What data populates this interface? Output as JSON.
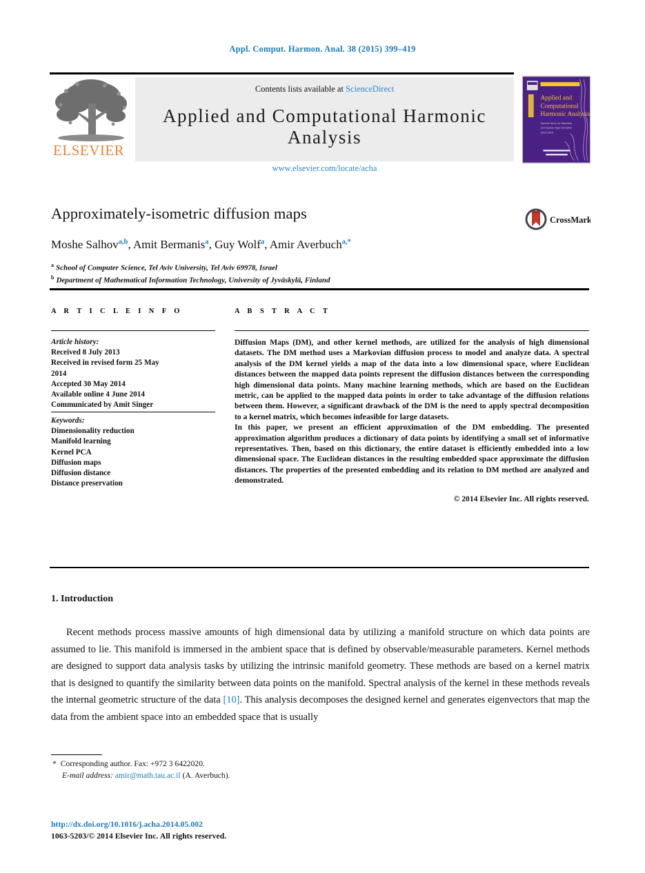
{
  "running_head": "Appl. Comput. Harmon. Anal. 38 (2015) 399–419",
  "masthead": {
    "publisher_name": "ELSEVIER",
    "publisher_logo_icon": "elsevier-tree-icon",
    "contents_prefix": "Contents lists available at",
    "contents_link": "ScienceDirect",
    "journal_title": "Applied and Computational Harmonic Analysis",
    "journal_url": "www.elsevier.com/locate/acha",
    "cover": {
      "line1": "Applied and",
      "line2": "Computational",
      "line3": "Harmonic Analysis",
      "background": "#4b2083",
      "accent": "#f2c430"
    }
  },
  "article": {
    "title": "Approximately-isometric diffusion maps",
    "crossmark_label": "CrossMark",
    "crossmark_icon": "crossmark-icon",
    "authors": [
      {
        "name": "Moshe Salhov",
        "marks": "a,b"
      },
      {
        "name": "Amit Bermanis",
        "marks": "a"
      },
      {
        "name": "Guy Wolf",
        "marks": "a"
      },
      {
        "name": "Amir Averbuch",
        "marks": "a,*"
      }
    ],
    "affiliations": [
      {
        "mark": "a",
        "text": "School of Computer Science, Tel Aviv University, Tel Aviv 69978, Israel"
      },
      {
        "mark": "b",
        "text": "Department of Mathematical Information Technology, University of Jyväskylä, Finland"
      }
    ]
  },
  "info": {
    "heading": "A R T I C L E   I N F O",
    "history_label": "Article history:",
    "history": [
      "Received 8 July 2013",
      "Received in revised form 25 May",
      "2014",
      "Accepted 30 May 2014",
      "Available online 4 June 2014",
      "Communicated by Amit Singer"
    ],
    "keywords_label": "Keywords:",
    "keywords": [
      "Dimensionality reduction",
      "Manifold learning",
      "Kernel PCA",
      "Diffusion maps",
      "Diffusion distance",
      "Distance preservation"
    ]
  },
  "abstract": {
    "heading": "A B S T R A C T",
    "paragraphs": [
      "Diffusion Maps (DM), and other kernel methods, are utilized for the analysis of high dimensional datasets. The DM method uses a Markovian diffusion process to model and analyze data. A spectral analysis of the DM kernel yields a map of the data into a low dimensional space, where Euclidean distances between the mapped data points represent the diffusion distances between the corresponding high dimensional data points. Many machine learning methods, which are based on the Euclidean metric, can be applied to the mapped data points in order to take advantage of the diffusion relations between them. However, a significant drawback of the DM is the need to apply spectral decomposition to a kernel matrix, which becomes infeasible for large datasets.",
      "In this paper, we present an efficient approximation of the DM embedding. The presented approximation algorithm produces a dictionary of data points by identifying a small set of informative representatives. Then, based on this dictionary, the entire dataset is efficiently embedded into a low dimensional space. The Euclidean distances in the resulting embedded space approximate the diffusion distances. The properties of the presented embedding and its relation to DM method are analyzed and demonstrated."
    ],
    "copyright": "© 2014 Elsevier Inc. All rights reserved."
  },
  "body": {
    "section_heading": "1.  Introduction",
    "paragraph1_part1": "Recent methods process massive amounts of high dimensional data by utilizing a manifold structure on which data points are assumed to lie. This manifold is immersed in the ambient space that is defined by observable/measurable parameters. Kernel methods are designed to support data analysis tasks by utilizing the intrinsic manifold geometry. These methods are based on a kernel matrix that is designed to quantify the similarity between data points on the manifold. Spectral analysis of the kernel in these methods reveals the internal geometric structure of the data ",
    "citation": "[10]",
    "paragraph1_part2": ". This analysis decomposes the designed kernel and generates eigenvectors that map the data from the ambient space into an embedded space that is usually"
  },
  "footnotes": {
    "star": "*",
    "corresponding": "Corresponding author. Fax: +972 3 6422020.",
    "email_label": "E-mail address:",
    "email": "amir@math.tau.ac.il",
    "email_suffix": "(A. Averbuch).",
    "doi": "http://dx.doi.org/10.1016/j.acha.2014.05.002",
    "issn_line": "1063-5203/© 2014 Elsevier Inc. All rights reserved."
  },
  "colors": {
    "link": "#1a7cb8",
    "elsevier_orange": "#e8823a",
    "band": "#ececec"
  }
}
